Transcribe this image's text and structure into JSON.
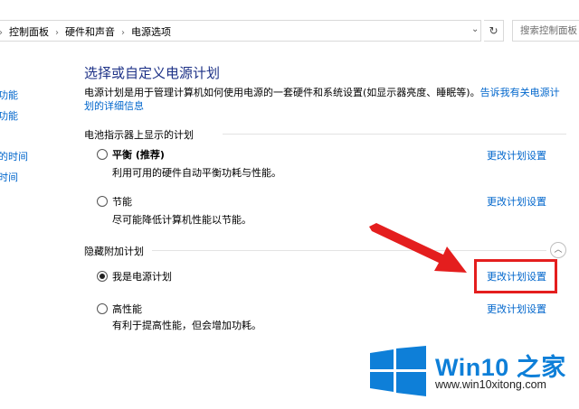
{
  "address_bar": {
    "breadcrumb": [
      "控制面板",
      "硬件和声音",
      "电源选项"
    ],
    "search_placeholder": "搜索控制面板"
  },
  "left_nav": {
    "items": [
      "功能",
      "功能",
      "的时间",
      "时间"
    ]
  },
  "main": {
    "title": "选择或自定义电源计划",
    "description": "电源计划是用于管理计算机如何使用电源的一套硬件和系统设置(如显示器亮度、睡眠等)。",
    "description_link": "告诉我有关电源计划的详细信息",
    "battery_section_label": "电池指示器上显示的计划",
    "hidden_section_label": "隐藏附加计划",
    "change_link": "更改计划设置",
    "plans": [
      {
        "name": "平衡 (推荐)",
        "description": "利用可用的硬件自动平衡功耗与性能。",
        "selected": false
      },
      {
        "name": "节能",
        "description": "尽可能降低计算机性能以节能。",
        "selected": false
      },
      {
        "name": "我是电源计划",
        "description": "",
        "selected": true
      },
      {
        "name": "高性能",
        "description": "有利于提高性能，但会增加功耗。",
        "selected": false
      }
    ]
  },
  "watermark": {
    "title": "Win10 之家",
    "url": "www.win10xitong.com",
    "colors": {
      "blue": "#0e7fd8",
      "arrow_red": "#e41e1e"
    }
  }
}
